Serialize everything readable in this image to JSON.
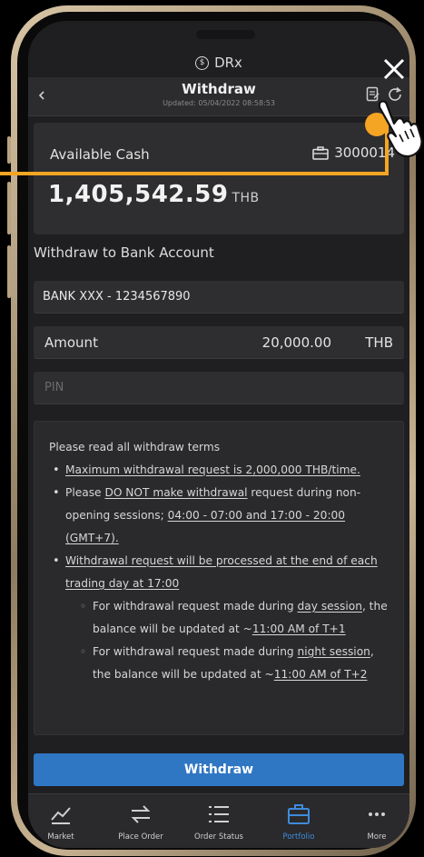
{
  "app": {
    "brand": "DRx"
  },
  "header": {
    "title": "Withdraw",
    "updated": "Updated: 05/04/2022 08:58:53"
  },
  "cash": {
    "label": "Available Cash",
    "account": "3000014",
    "amount": "1,405,542.59",
    "currency": "THB"
  },
  "withdraw_to": {
    "label": "Withdraw to Bank Account",
    "bank_value": "BANK XXX - 1234567890"
  },
  "amount_field": {
    "label": "Amount",
    "value": "20,000.00",
    "currency": "THB"
  },
  "pin_field": {
    "placeholder": "PIN"
  },
  "terms": {
    "title": "Please read all withdraw terms",
    "line1": "Maximum withdrawal request is 2,000,000 THB/time.",
    "line2_a": "Please ",
    "line2_b": "DO NOT make withdrawal",
    "line2_c": " request during non-opening sessions; ",
    "line2_d": "04:00 - 07:00 and 17:00 - 20:00 (GMT+7).",
    "line3": "Withdrawal request will be processed at the end of each trading day at 17:00",
    "sub1_a": "For withdrawal request made during ",
    "sub1_b": "day session",
    "sub1_c": ", the balance will be updated at ~",
    "sub1_d": "11:00 AM of T+1",
    "sub2_a": "For withdrawal request made during ",
    "sub2_b": "night session",
    "sub2_c": ", the balance will be updated at ~",
    "sub2_d": "11:00 AM of T+2"
  },
  "submit": {
    "label": "Withdraw"
  },
  "nav": [
    {
      "label": "Market",
      "icon": "chart-icon"
    },
    {
      "label": "Place Order",
      "icon": "swap-arrows-icon"
    },
    {
      "label": "Order Status",
      "icon": "list-icon"
    },
    {
      "label": "Portfolio",
      "icon": "briefcase-icon",
      "active": true
    },
    {
      "label": "More",
      "icon": "more-icon"
    }
  ],
  "colors": {
    "accent": "#2f77c3",
    "active_nav": "#3f8bdc",
    "pointer": "#f4a523"
  }
}
